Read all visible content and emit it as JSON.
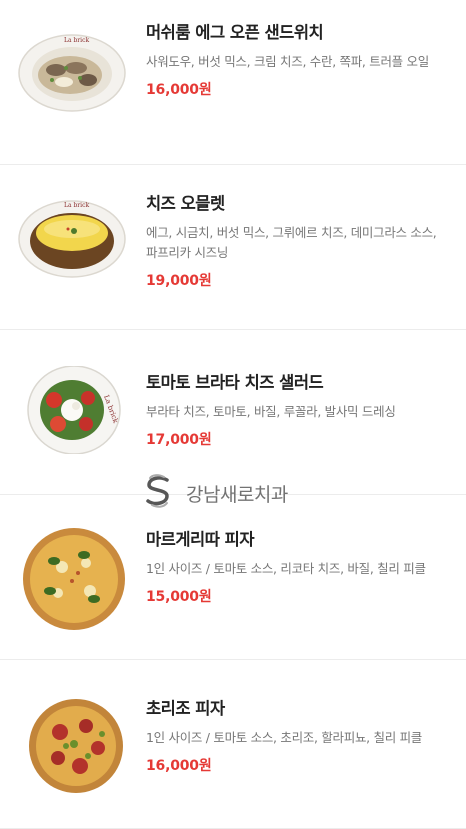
{
  "colors": {
    "price": "#e53935",
    "name": "#222222",
    "desc": "#777777",
    "divider": "#ececec"
  },
  "watermark": {
    "text": "강남새로치과",
    "icon": "clinic-logo-icon"
  },
  "menu": [
    {
      "name": "머쉬룸 에그 오픈 샌드위치",
      "description": "사워도우, 버섯 믹스, 크림 치즈, 수란, 쪽파, 트러플 오일",
      "price": "16,000원",
      "image": "mushroom-egg-sandwich-image"
    },
    {
      "name": "치즈 오믈렛",
      "description": "에그, 시금치, 버섯 믹스, 그뤼에르 치즈, 데미그라스 소스, 파프리카 시즈닝",
      "price": "19,000원",
      "image": "cheese-omelette-image"
    },
    {
      "name": "토마토 브라타 치즈 샐러드",
      "description": "부라타 치즈, 토마토, 바질, 루꼴라, 발사믹 드레싱",
      "price": "17,000원",
      "image": "tomato-burrata-salad-image"
    },
    {
      "name": "마르게리따 피자",
      "description": "1인 사이즈 / 토마토 소스, 리코타 치즈, 바질, 칠리 피클",
      "price": "15,000원",
      "image": "margherita-pizza-image"
    },
    {
      "name": "초리조 피자",
      "description": "1인 사이즈 / 토마토 소스, 초리조, 할라피뇨, 칠리 피클",
      "price": "16,000원",
      "image": "chorizo-pizza-image"
    }
  ]
}
